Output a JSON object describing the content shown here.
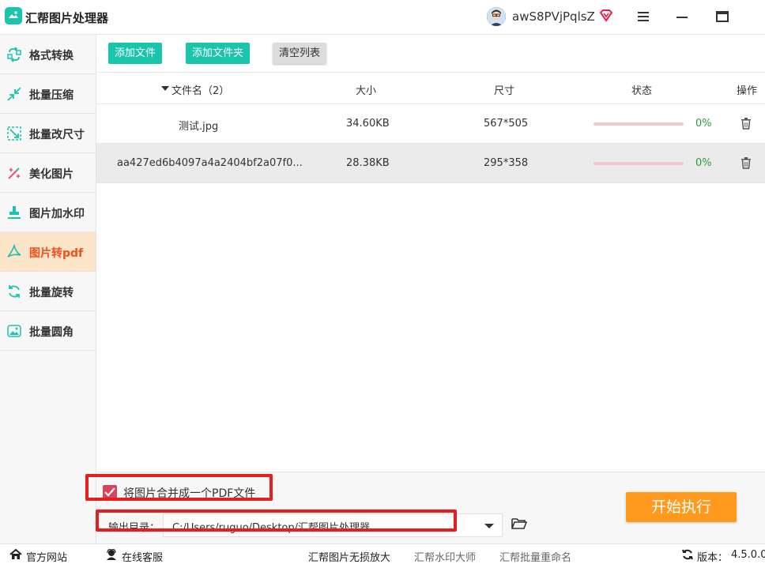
{
  "app": {
    "title": "汇帮图片处理器",
    "username": "awS8PVjPqlsZ"
  },
  "sidebar": {
    "items": [
      {
        "label": "格式转换",
        "icon": "format-convert-icon",
        "active": false
      },
      {
        "label": "批量压缩",
        "icon": "compress-icon",
        "active": false
      },
      {
        "label": "批量改尺寸",
        "icon": "resize-icon",
        "active": false
      },
      {
        "label": "美化图片",
        "icon": "beautify-icon",
        "active": false
      },
      {
        "label": "图片加水印",
        "icon": "watermark-icon",
        "active": false
      },
      {
        "label": "图片转pdf",
        "icon": "pdf-icon",
        "active": true
      },
      {
        "label": "批量旋转",
        "icon": "rotate-icon",
        "active": false
      },
      {
        "label": "批量圆角",
        "icon": "round-corner-icon",
        "active": false
      }
    ]
  },
  "toolbar": {
    "add_file": "添加文件",
    "add_folder": "添加文件夹",
    "clear_list": "清空列表"
  },
  "table": {
    "headers": {
      "filename": "文件名（2）",
      "size": "大小",
      "dimensions": "尺寸",
      "status": "状态",
      "actions": "操作"
    },
    "rows": [
      {
        "filename": "测试.jpg",
        "size": "34.60KB",
        "dimensions": "567*505",
        "progress": "0%"
      },
      {
        "filename": "aa427ed6b4097a4a2404bf2a07f0...",
        "size": "28.38KB",
        "dimensions": "295*358",
        "progress": "0%"
      }
    ]
  },
  "options": {
    "merge_label": "将图片合并成一个PDF文件",
    "merge_checked": true,
    "output_label": "输出目录：",
    "output_path": "C:/Users/ruguo/Desktop/汇帮图片处理器",
    "start_button": "开始执行"
  },
  "statusbar": {
    "website": "官方网站",
    "support": "在线客服",
    "link1": "汇帮图片无损放大",
    "link2": "汇帮水印大师",
    "link3": "汇帮批量重命名",
    "version_label": "版本：",
    "version": "4.5.0.0"
  },
  "colors": {
    "accent": "#19c6ad",
    "active_bg": "#fce4c8",
    "active_text": "#f0501e",
    "start": "#ff9a1f",
    "highlight": "#e81d1d"
  }
}
